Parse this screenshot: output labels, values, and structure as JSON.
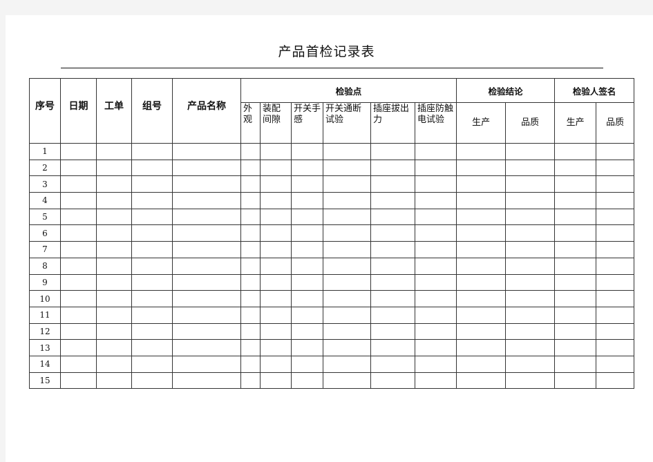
{
  "document": {
    "title": "产品首检记录表"
  },
  "table": {
    "headers": {
      "seq": "序号",
      "date": "日期",
      "work_order": "工单",
      "group_no": "组号",
      "product_name": "产品名称",
      "inspection_points": {
        "label": "检验点",
        "items": [
          "外观",
          "装配间隙",
          "开关手感",
          "开关通断试验",
          "插座拔出力",
          "插座防触电试验"
        ]
      },
      "inspection_conclusion": {
        "label": "检验结论",
        "items": [
          "生产",
          "品质"
        ]
      },
      "inspector_signature": {
        "label": "检验人签名",
        "items": [
          "生产",
          "品质"
        ]
      }
    },
    "rows": [
      "1",
      "2",
      "3",
      "4",
      "5",
      "6",
      "7",
      "8",
      "9",
      "10",
      "11",
      "12",
      "13",
      "14",
      "15"
    ]
  }
}
